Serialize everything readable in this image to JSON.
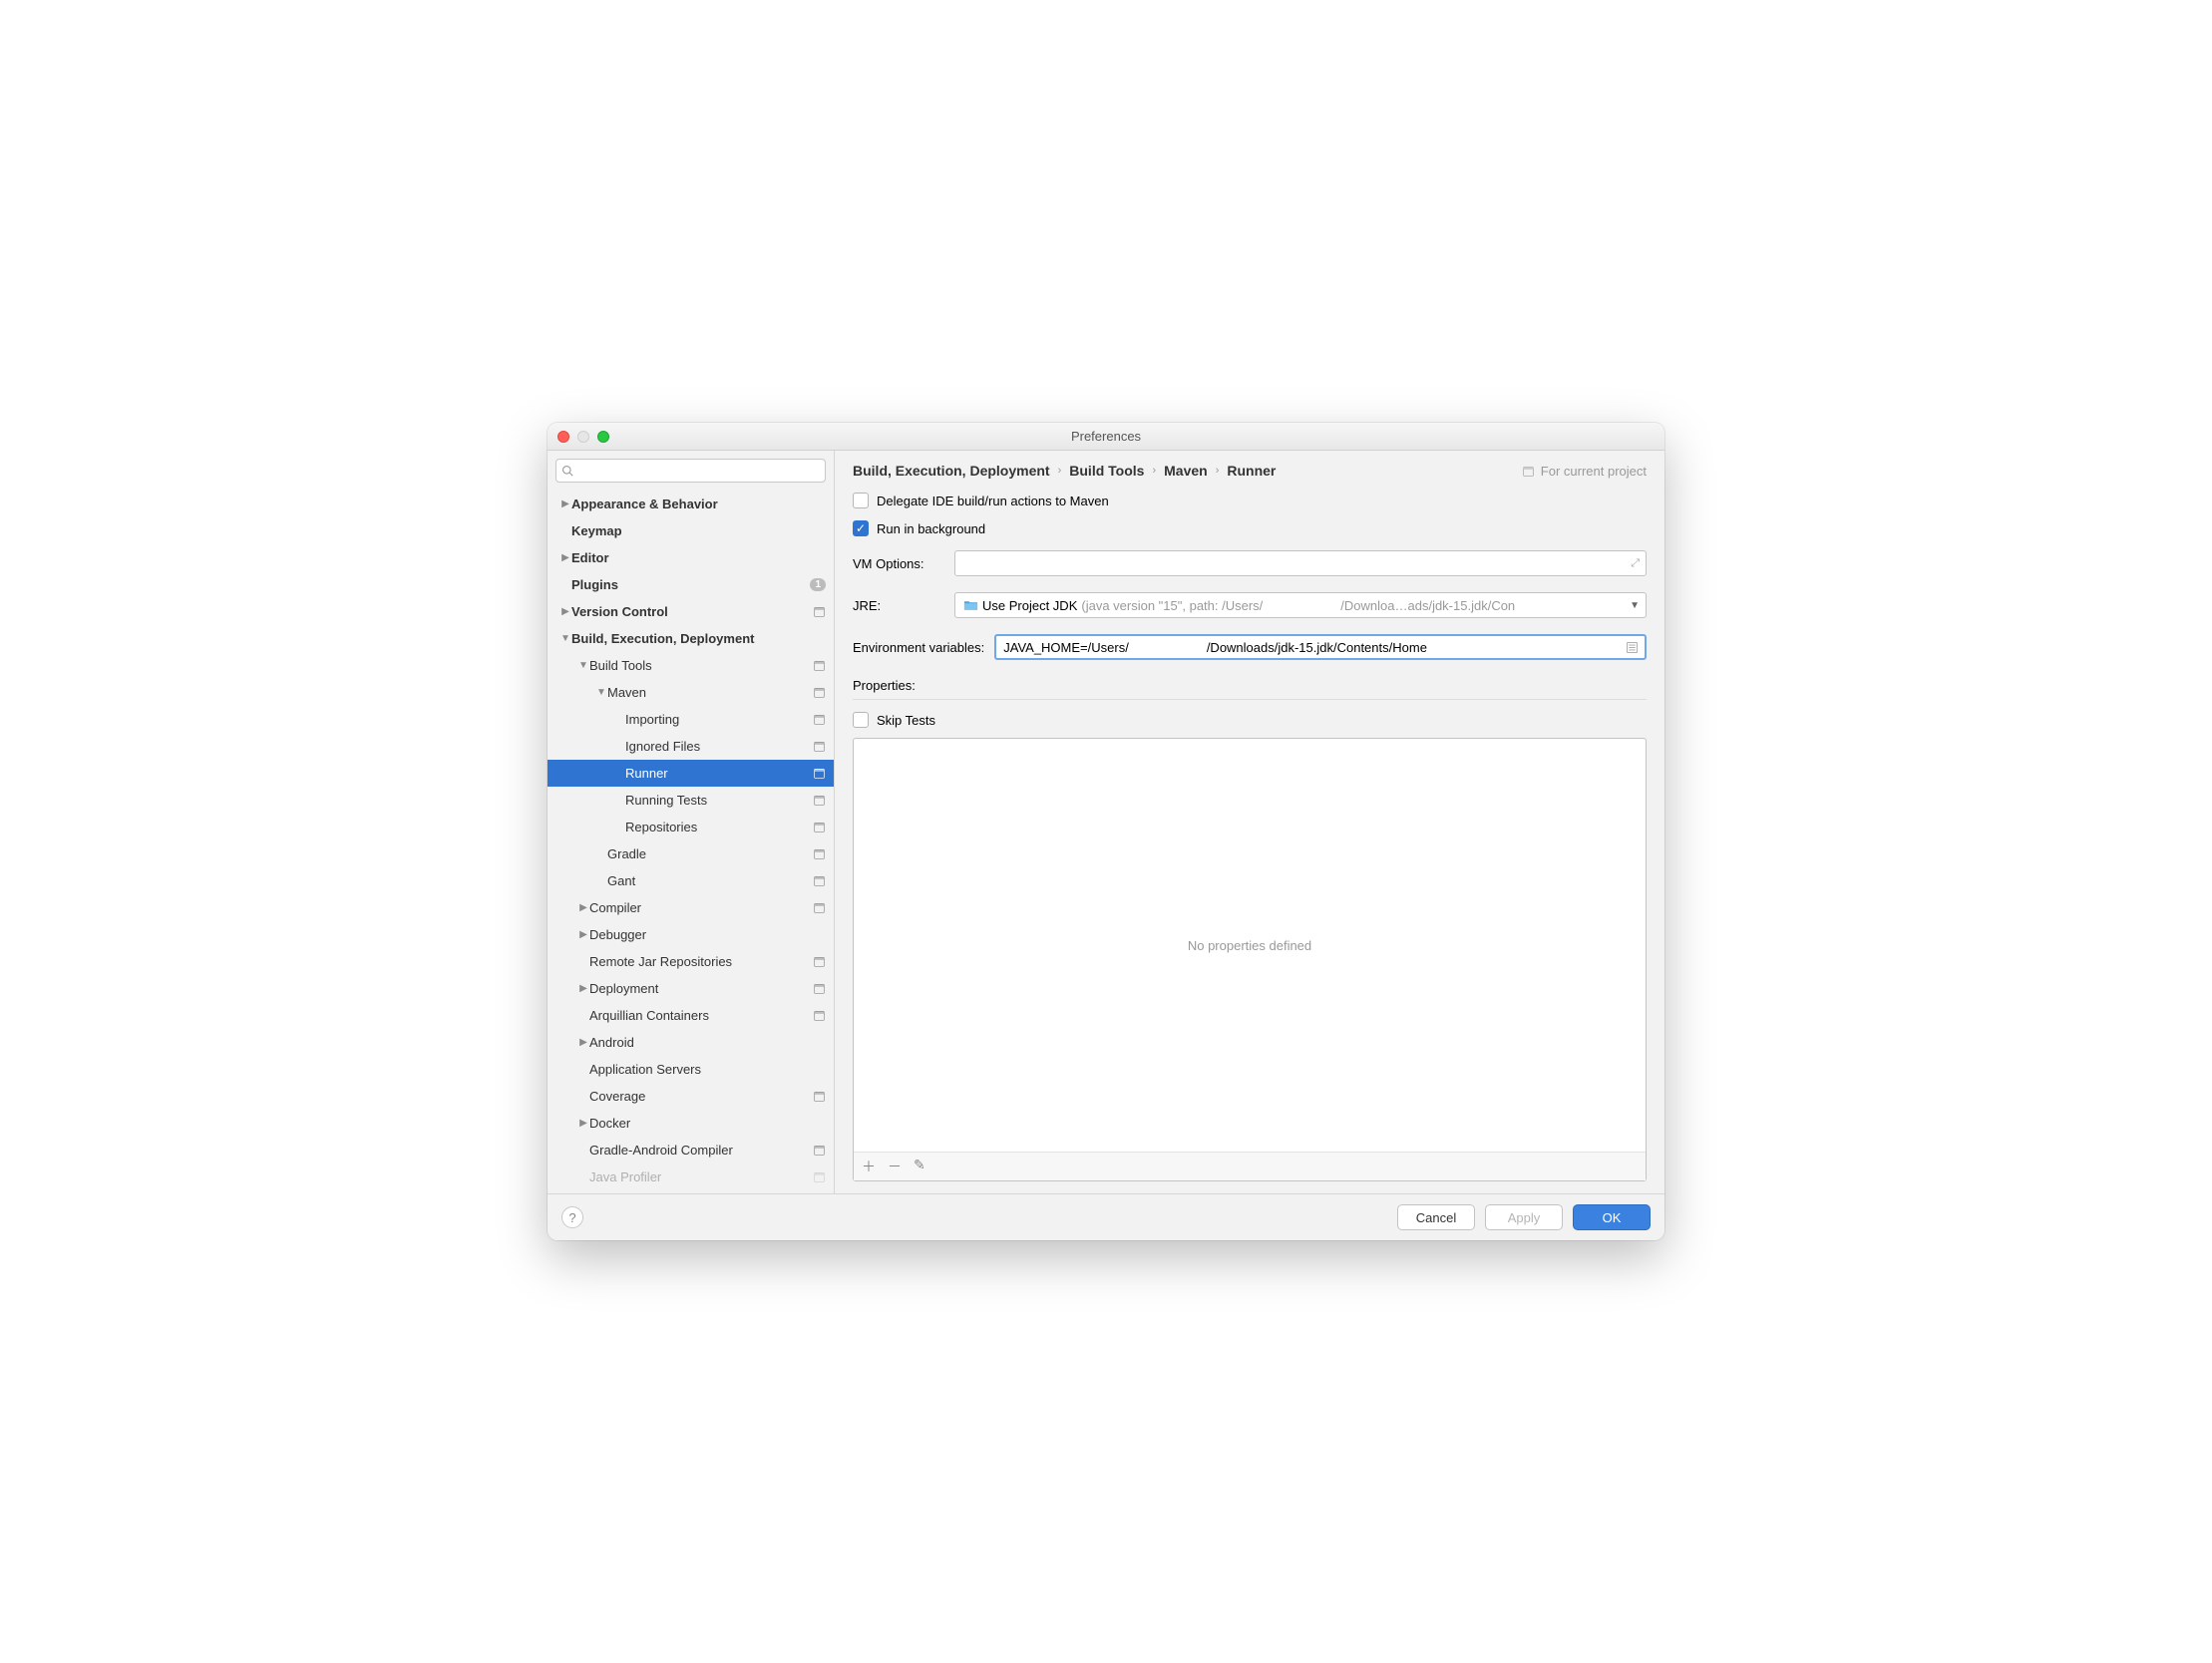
{
  "window": {
    "title": "Preferences"
  },
  "sidebar": {
    "search_placeholder": "",
    "items": [
      {
        "label": "Appearance & Behavior",
        "level": 0,
        "arrow": "right",
        "bold": true
      },
      {
        "label": "Keymap",
        "level": 0,
        "arrow": "none",
        "bold": true
      },
      {
        "label": "Editor",
        "level": 0,
        "arrow": "right",
        "bold": true
      },
      {
        "label": "Plugins",
        "level": 0,
        "arrow": "none",
        "bold": true,
        "badge": "1"
      },
      {
        "label": "Version Control",
        "level": 0,
        "arrow": "right",
        "bold": true,
        "proj": true
      },
      {
        "label": "Build, Execution, Deployment",
        "level": 0,
        "arrow": "down",
        "bold": true
      },
      {
        "label": "Build Tools",
        "level": 1,
        "arrow": "down",
        "proj": true
      },
      {
        "label": "Maven",
        "level": 2,
        "arrow": "down",
        "proj": true
      },
      {
        "label": "Importing",
        "level": 3,
        "arrow": "none",
        "proj": true
      },
      {
        "label": "Ignored Files",
        "level": 3,
        "arrow": "none",
        "proj": true
      },
      {
        "label": "Runner",
        "level": 3,
        "arrow": "none",
        "proj": true,
        "selected": true
      },
      {
        "label": "Running Tests",
        "level": 3,
        "arrow": "none",
        "proj": true
      },
      {
        "label": "Repositories",
        "level": 3,
        "arrow": "none",
        "proj": true
      },
      {
        "label": "Gradle",
        "level": 2,
        "arrow": "none",
        "proj": true
      },
      {
        "label": "Gant",
        "level": 2,
        "arrow": "none",
        "proj": true
      },
      {
        "label": "Compiler",
        "level": 1,
        "arrow": "right",
        "proj": true
      },
      {
        "label": "Debugger",
        "level": 1,
        "arrow": "right"
      },
      {
        "label": "Remote Jar Repositories",
        "level": 1,
        "arrow": "none",
        "proj": true
      },
      {
        "label": "Deployment",
        "level": 1,
        "arrow": "right",
        "proj": true
      },
      {
        "label": "Arquillian Containers",
        "level": 1,
        "arrow": "none",
        "proj": true
      },
      {
        "label": "Android",
        "level": 1,
        "arrow": "right"
      },
      {
        "label": "Application Servers",
        "level": 1,
        "arrow": "none"
      },
      {
        "label": "Coverage",
        "level": 1,
        "arrow": "none",
        "proj": true
      },
      {
        "label": "Docker",
        "level": 1,
        "arrow": "right"
      },
      {
        "label": "Gradle-Android Compiler",
        "level": 1,
        "arrow": "none",
        "proj": true
      },
      {
        "label": "Java Profiler",
        "level": 1,
        "arrow": "none",
        "proj": true,
        "faded": true
      }
    ]
  },
  "breadcrumb": {
    "c1": "Build, Execution, Deployment",
    "c2": "Build Tools",
    "c3": "Maven",
    "c4": "Runner",
    "for_project": "For current project"
  },
  "form": {
    "delegate_label": "Delegate IDE build/run actions to Maven",
    "delegate_checked": false,
    "runbg_label": "Run in background",
    "runbg_checked": true,
    "vm_label": "VM Options:",
    "vm_value": "",
    "jre_label": "JRE:",
    "jre_prefix": "Use Project JDK",
    "jre_gray1": " (java version \"15\", path: /Users/",
    "jre_gray2": "/Downloa…ads/jdk-15.jdk/Con",
    "env_label": "Environment variables:",
    "env_prefix": "JAVA_HOME=/Users/",
    "env_suffix": "/Downloads/jdk-15.jdk/Contents/Home",
    "properties_label": "Properties:",
    "skip_tests_label": "Skip Tests",
    "no_props": "No properties defined"
  },
  "buttons": {
    "cancel": "Cancel",
    "apply": "Apply",
    "ok": "OK"
  }
}
